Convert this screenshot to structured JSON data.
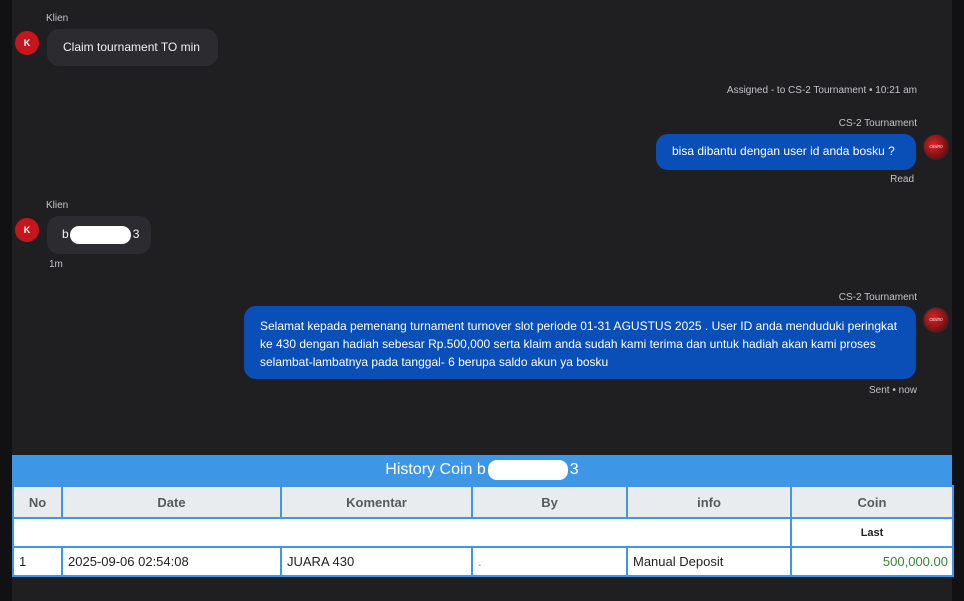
{
  "chat": {
    "msg1": {
      "sender": "Klien",
      "avatar": "K",
      "text": "Claim tournament TO min"
    },
    "system_note": "Assigned - to CS-2 Tournament • 10:21 am",
    "msg2": {
      "sender": "CS-2 Tournament",
      "text": "bisa dibantu dengan user id anda bosku ?",
      "status": "Read"
    },
    "msg3": {
      "sender": "Klien",
      "avatar": "K",
      "text_start": "b",
      "text_end": "3",
      "time": "1m"
    },
    "msg4": {
      "sender": "CS-2 Tournament",
      "text": "Selamat kepada pemenang turnament turnover slot periode 01-31 AGUSTUS 2025 . User ID anda menduduki peringkat ke 430 dengan hadiah sebesar Rp.500,000 serta klaim anda sudah kami terima dan untuk hadiah akan kami proses selambat-lambatnya pada tanggal- 6 berupa saldo akun ya bosku",
      "status": "Sent • now"
    }
  },
  "history": {
    "title_start": "History Coin b",
    "title_end": "3",
    "columns": [
      "No",
      "Date",
      "Komentar",
      "By",
      "info",
      "Coin"
    ],
    "last_label": "Last",
    "rows": [
      {
        "no": "1",
        "date": "2025-09-06 02:54:08",
        "komentar": "JUARA 430",
        "by": ".",
        "info": "Manual Deposit",
        "coin": "500,000.00"
      }
    ]
  },
  "colors": {
    "agent_bubble": "#0a4fb8",
    "client_bubble": "#2c2c30",
    "table_header": "#3d97e6",
    "coin_positive": "#2e8b2e"
  }
}
